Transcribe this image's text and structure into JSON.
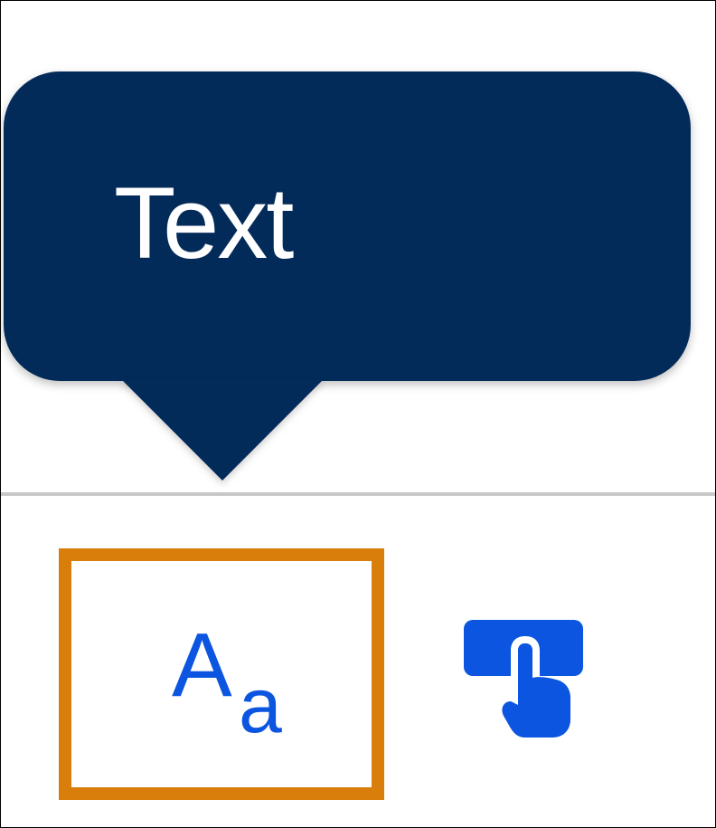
{
  "tooltip": {
    "label": "Text",
    "background_color": "#032b5a",
    "text_color": "#ffffff"
  },
  "toolbar": {
    "tools": [
      {
        "icon": "text-format-icon",
        "glyph_large": "A",
        "glyph_small": "a",
        "selected": true,
        "highlight_color": "#d97d0b"
      },
      {
        "icon": "touch-gesture-icon",
        "selected": false
      }
    ],
    "icon_color": "#0b55e0",
    "divider_color": "#c8c8c8"
  }
}
